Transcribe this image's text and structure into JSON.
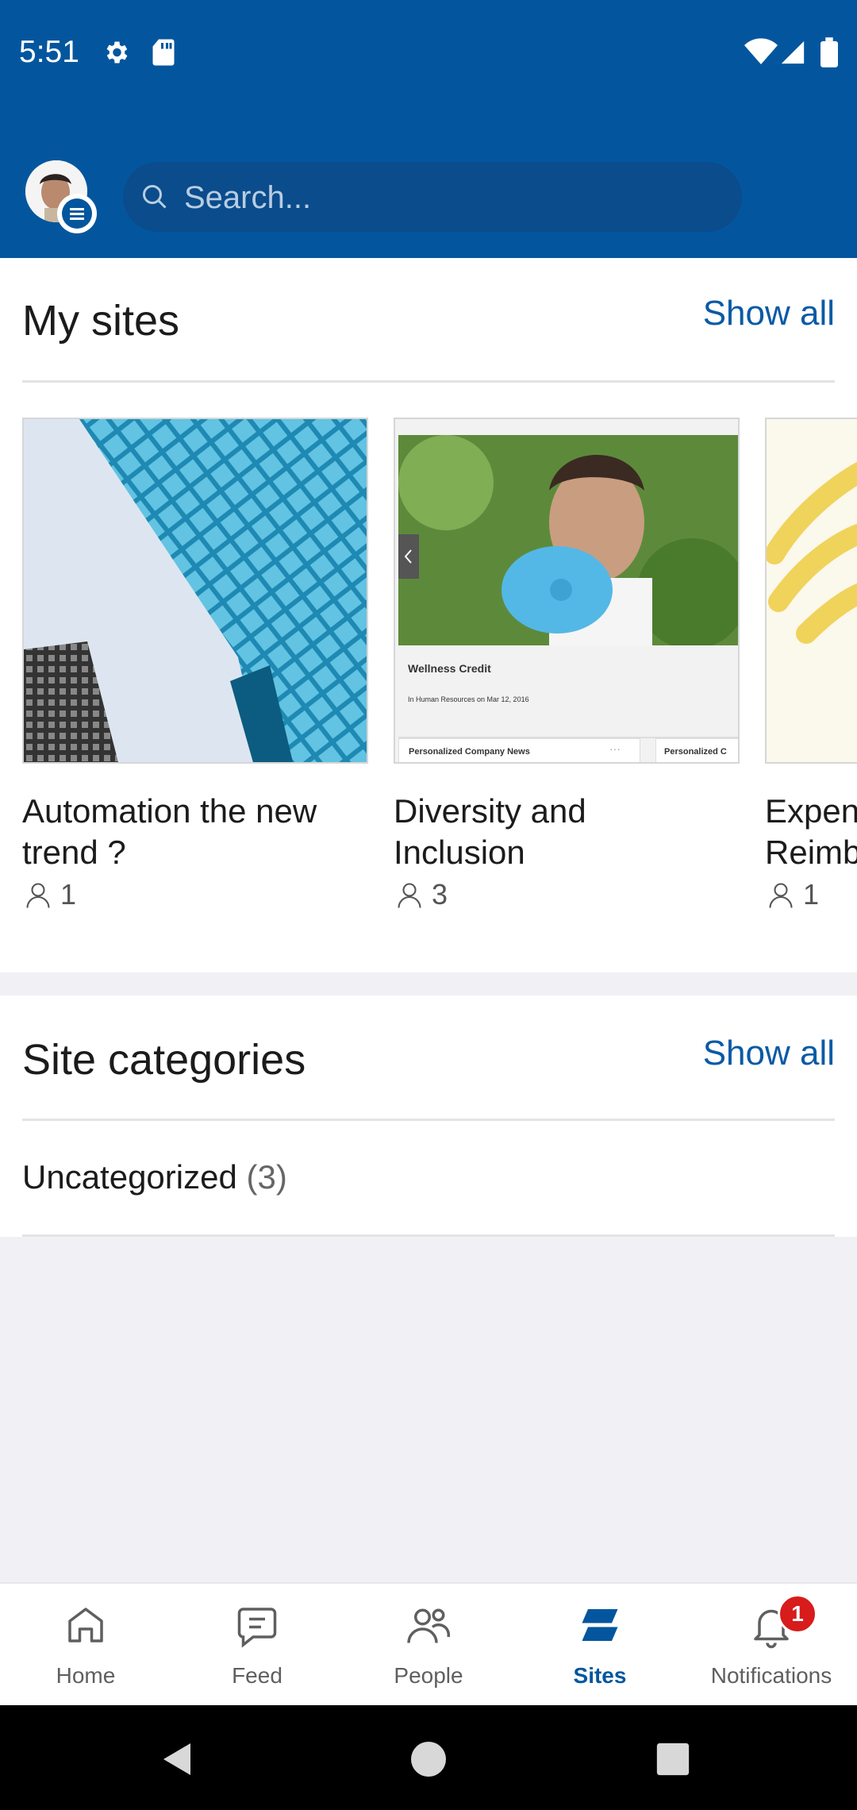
{
  "status": {
    "time": "5:51"
  },
  "search": {
    "placeholder": "Search..."
  },
  "my_sites": {
    "title": "My sites",
    "show_all": "Show all",
    "cards": [
      {
        "title": "Automation the new trend ?",
        "members": "1"
      },
      {
        "title": "Diversity and Inclusion",
        "members": "3",
        "preview": {
          "news_title": "Wellness Credit",
          "news_meta": "In Human Resources on Mar 12, 2016",
          "tab1": "Personalized Company News",
          "tab2": "Personalized C"
        }
      },
      {
        "title": "Expen Reimb",
        "members": "1"
      }
    ]
  },
  "site_categories": {
    "title": "Site categories",
    "show_all": "Show all",
    "items": [
      {
        "label": "Uncategorized",
        "count": "(3)"
      }
    ]
  },
  "bottom_nav": {
    "items": [
      {
        "label": "Home",
        "icon": "home-icon",
        "active": false
      },
      {
        "label": "Feed",
        "icon": "feed-icon",
        "active": false
      },
      {
        "label": "People",
        "icon": "people-icon",
        "active": false
      },
      {
        "label": "Sites",
        "icon": "sites-icon",
        "active": true
      },
      {
        "label": "Notifications",
        "icon": "bell-icon",
        "active": false
      }
    ],
    "notification_badge": "1"
  },
  "colors": {
    "brand": "#03569e",
    "accent": "#0a5aa5",
    "badge": "#d81b1b"
  }
}
